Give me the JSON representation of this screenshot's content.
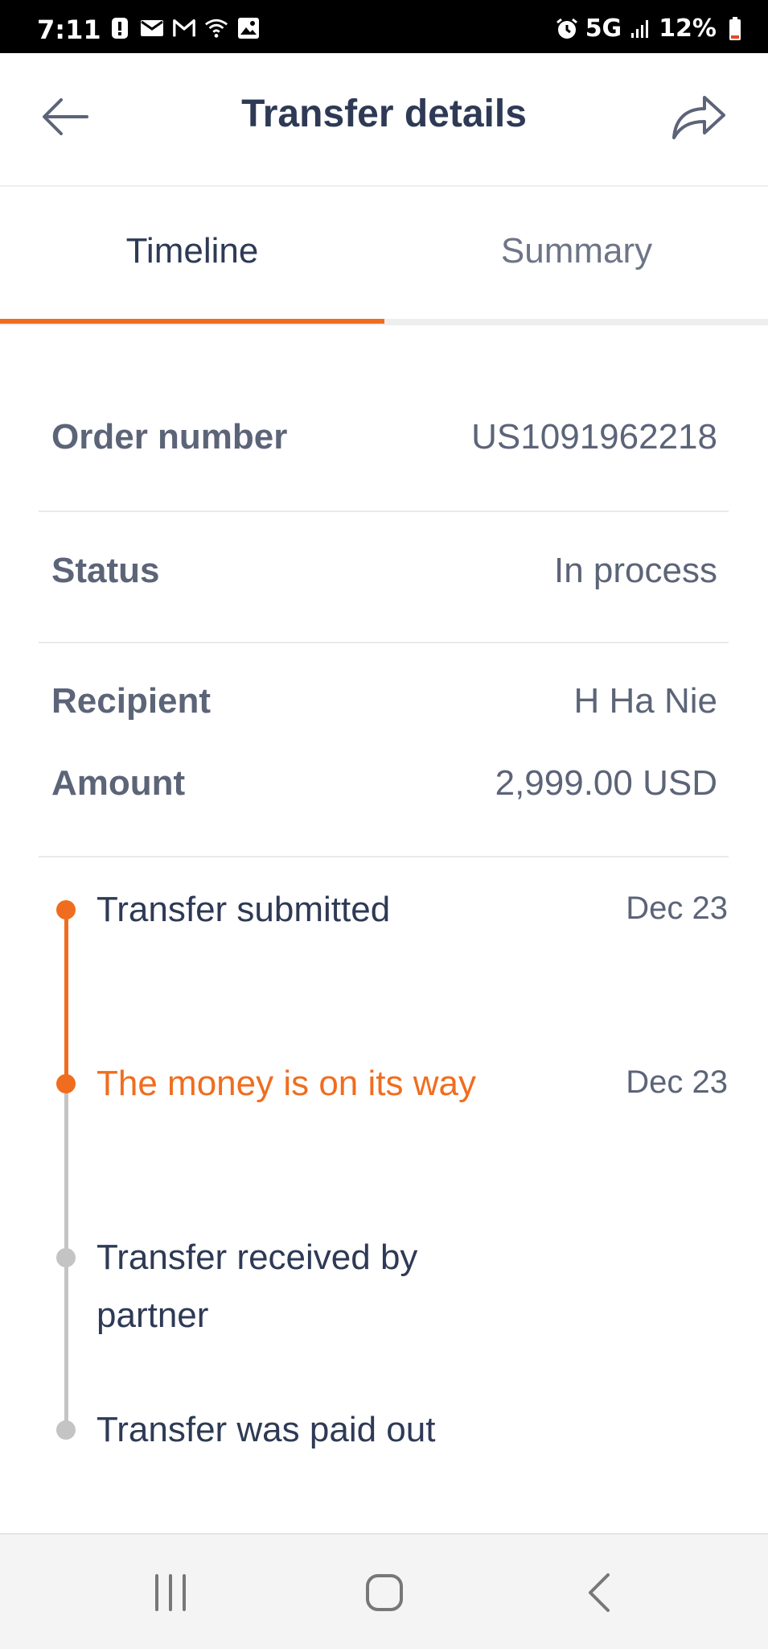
{
  "status_bar": {
    "time": "7:11",
    "network": "5G",
    "battery": "12%",
    "left_icons": [
      "alert-icon",
      "mail-icon",
      "gmail-icon",
      "wifi-calling-icon",
      "image-icon"
    ],
    "right_icons": [
      "alarm-icon",
      "signal-icon",
      "battery-icon"
    ]
  },
  "header": {
    "title": "Transfer details",
    "back_icon": "arrow-left-icon",
    "share_icon": "share-icon"
  },
  "tabs": [
    {
      "label": "Timeline",
      "active": true
    },
    {
      "label": "Summary",
      "active": false
    }
  ],
  "details": {
    "order_number_label": "Order number",
    "order_number_value": "US1091962218",
    "status_label": "Status",
    "status_value": "In process",
    "recipient_label": "Recipient",
    "recipient_value": "H Ha Nie",
    "amount_label": "Amount",
    "amount_value": "2,999.00 USD"
  },
  "timeline": [
    {
      "label": "Transfer submitted",
      "date": "Dec 23",
      "state": "done"
    },
    {
      "label": "The money is on its way",
      "date": "Dec 23",
      "state": "current"
    },
    {
      "label_line1": "Transfer received by",
      "label_line2": "partner",
      "date": "",
      "state": "pending"
    },
    {
      "label": "Transfer was paid out",
      "date": "",
      "state": "pending"
    }
  ],
  "colors": {
    "accent": "#f06d1f",
    "text_dark": "#2e3a55",
    "text_muted": "#5c6478",
    "pending": "#c4c4c4"
  },
  "nav_bar": {
    "icons": [
      "recent-apps-icon",
      "home-icon",
      "back-icon"
    ]
  }
}
